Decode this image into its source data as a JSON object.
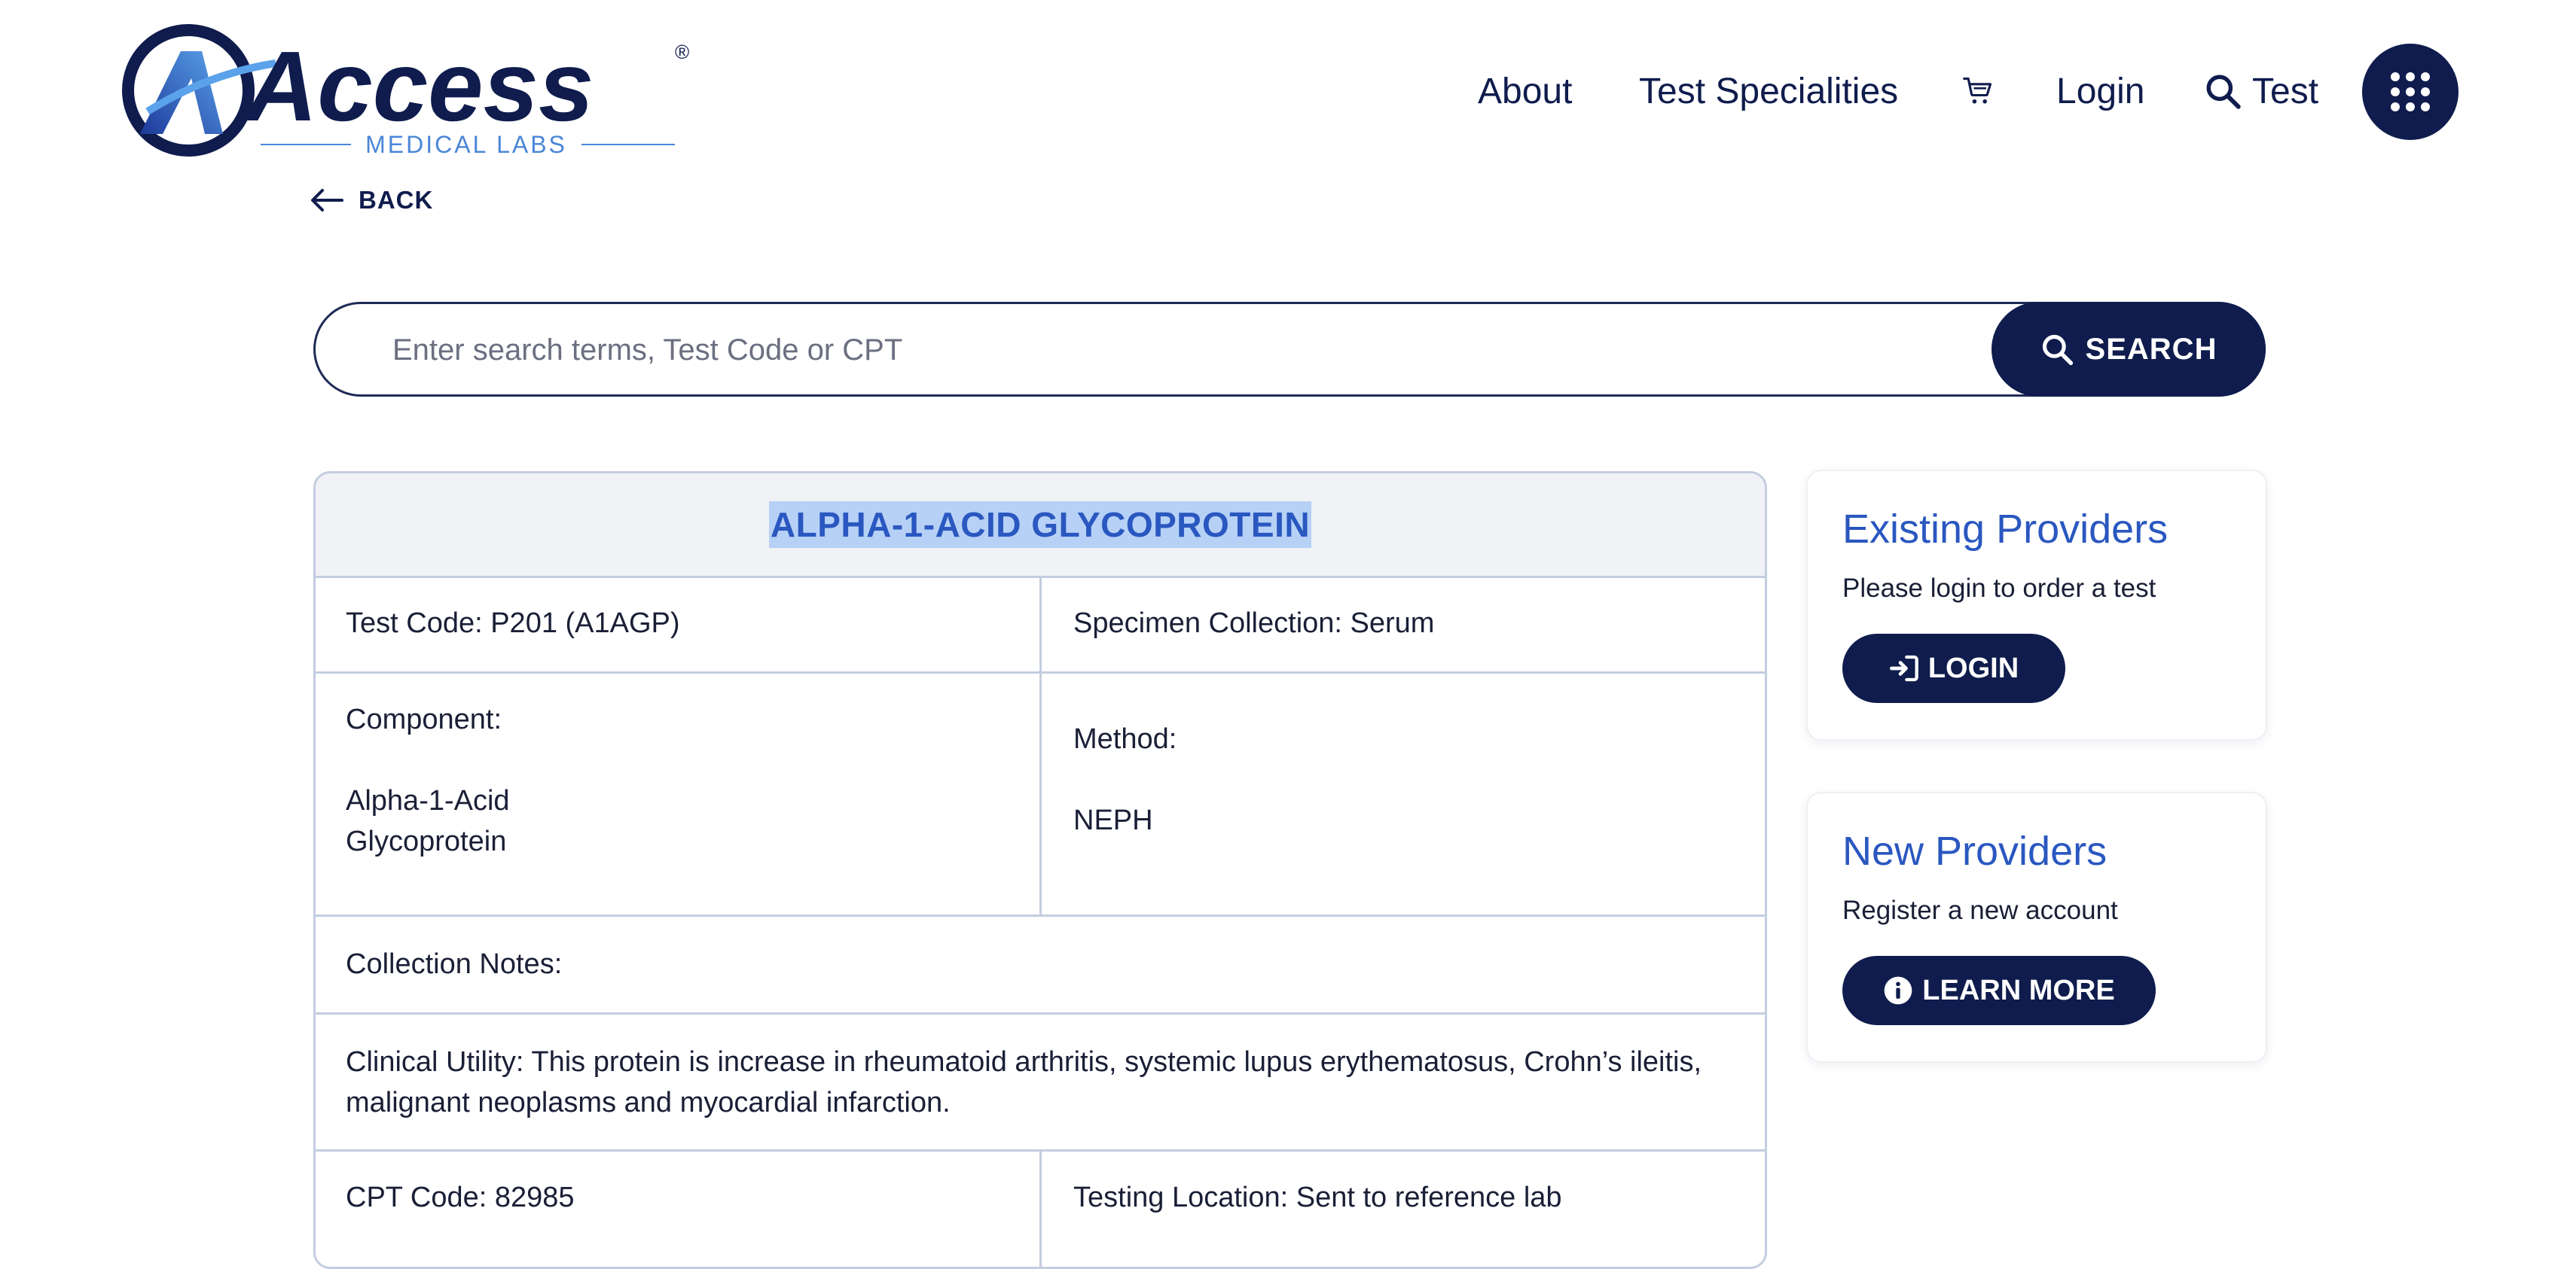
{
  "brand": {
    "name": "Access",
    "tagline": "MEDICAL LABS",
    "registered": "®"
  },
  "nav": {
    "about": "About",
    "test_specialities": "Test Specialities",
    "login": "Login",
    "search_test": "Test"
  },
  "back": {
    "label": "BACK"
  },
  "search": {
    "placeholder": "Enter search terms, Test Code or CPT",
    "value": "",
    "button_label": "SEARCH"
  },
  "test": {
    "title": "ALPHA-1-ACID GLYCOPROTEIN",
    "test_code": "Test Code: P201 (A1AGP)",
    "specimen_collection": "Specimen Collection: Serum",
    "component_label": "Component:",
    "component_value_line1": "Alpha-1-Acid",
    "component_value_line2": "Glycoprotein",
    "method_label": "Method:",
    "method_value": "NEPH",
    "collection_notes": "Collection Notes:",
    "clinical_utility": "Clinical Utility: This protein is increase in rheumatoid arthritis, systemic lupus erythematosus, Crohn’s ileitis, malignant neoplasms and myocardial infarction.",
    "cpt_code": "CPT Code: 82985",
    "testing_location": "Testing Location: Sent to reference lab"
  },
  "existing_providers": {
    "title": "Existing Providers",
    "text": "Please login to order a test",
    "button_label": "LOGIN"
  },
  "new_providers": {
    "title": "New Providers",
    "text": "Register a new account",
    "button_label": "LEARN MORE"
  },
  "colors": {
    "navy": "#0f1c4d",
    "accent_blue": "#2a57c0",
    "highlight": "#b6d1f5",
    "border": "#c3cde0"
  }
}
